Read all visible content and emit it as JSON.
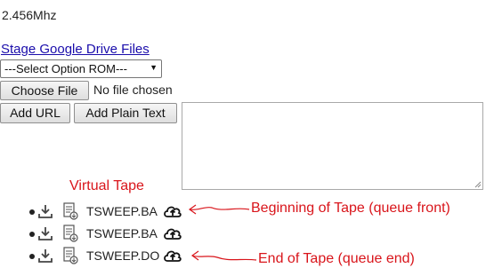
{
  "clock": {
    "frequency": "2.456Mhz"
  },
  "storage": {
    "gdrive_link": "Stage Google Drive Files",
    "rom_select": {
      "selected": "---Select Option ROM---"
    }
  },
  "file_input": {
    "button_label": "Choose File",
    "status": "No file chosen"
  },
  "buttons": {
    "add_url": "Add URL",
    "add_plain_text": "Add Plain Text"
  },
  "text_area": {
    "value": ""
  },
  "annotations": {
    "virtual_tape": "Virtual Tape",
    "beginning": "Beginning of Tape (queue front)",
    "end": "End of Tape (queue end)",
    "color": "#d9151b"
  },
  "tape": {
    "items": [
      {
        "name": "TSWEEP.BA",
        "icons": [
          "download-icon",
          "document-icon",
          "cloud-upload-icon"
        ]
      },
      {
        "name": "TSWEEP.BA",
        "icons": [
          "download-icon",
          "document-icon",
          "cloud-upload-icon"
        ]
      },
      {
        "name": "TSWEEP.DO",
        "icons": [
          "download-icon",
          "document-icon",
          "cloud-upload-icon"
        ]
      }
    ]
  }
}
